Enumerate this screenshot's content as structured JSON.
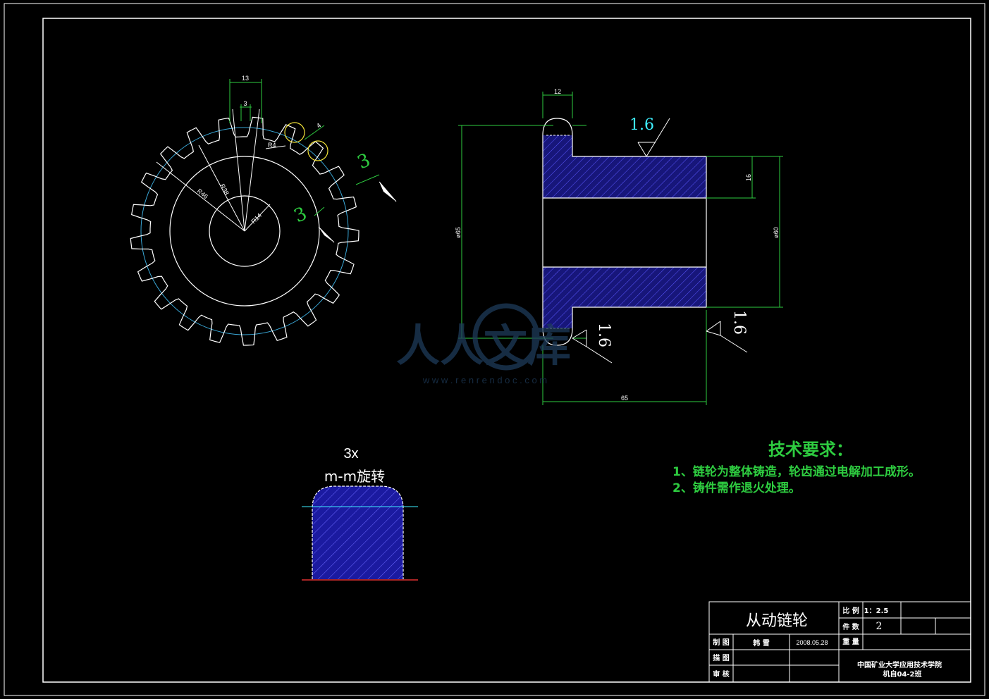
{
  "front_view": {
    "dims": {
      "d13": "13",
      "d3": "3",
      "r4": "R4",
      "d4": "4",
      "r38": "R38",
      "r46": "R46",
      "r14": "R14"
    },
    "roughness": [
      "3",
      "3"
    ]
  },
  "side_view": {
    "dims": {
      "d12": "12",
      "d16": "16",
      "phi65": "ø65",
      "phi60": "ø60",
      "d65": "65"
    },
    "roughness": [
      "1.6",
      "1.6",
      "1.6"
    ]
  },
  "detail": {
    "scale": "3x",
    "label": "m-m旋转"
  },
  "watermark": {
    "text": "人人文库",
    "url": "w w w . r e n r e n d o c . c o m"
  },
  "tech_req": {
    "title": "技术要求：",
    "items": [
      "1、链轮为整体铸造，轮齿通过电解加工成形。",
      "2、铸件需作退火处理。"
    ]
  },
  "title_block": {
    "part_name": "从动链轮",
    "scale_label": "比 例",
    "scale_value": "1：2.5",
    "qty_label": "件 数",
    "qty_value": "2",
    "weight_label": "重 量",
    "drawn_label": "制 图",
    "drawn_name": "韩 雪",
    "drawn_date": "2008.05.28",
    "traced_label": "描 图",
    "checked_label": "审 核",
    "school": "中国矿业大学应用技术学院",
    "class": "机自04-2班"
  }
}
